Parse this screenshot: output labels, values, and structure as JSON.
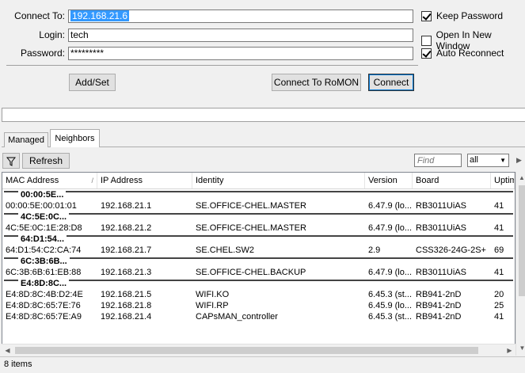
{
  "connect": {
    "connect_to_label": "Connect To:",
    "connect_to_value": "192.168.21.6",
    "login_label": "Login:",
    "login_value": "tech",
    "password_label": "Password:",
    "password_value": "*********",
    "keep_password_label": "Keep Password",
    "keep_password_checked": true,
    "open_new_window_label": "Open In New Window",
    "open_new_window_checked": false,
    "auto_reconnect_label": "Auto Reconnect",
    "auto_reconnect_checked": true,
    "add_set_label": "Add/Set",
    "connect_romon_label": "Connect To RoMON",
    "connect_label": "Connect"
  },
  "tabs": [
    {
      "label": "Managed",
      "active": false
    },
    {
      "label": "Neighbors",
      "active": true
    }
  ],
  "toolbar": {
    "filter_icon": "filter-icon",
    "refresh_label": "Refresh",
    "find_placeholder": "Find",
    "scope_value": "all"
  },
  "table": {
    "columns": [
      "MAC Address",
      "IP Address",
      "Identity",
      "Version",
      "Board",
      "Uptime"
    ],
    "groups": [
      {
        "label": "00:00:5E...",
        "rows": [
          [
            "00:00:5E:00:01:01",
            "192.168.21.1",
            "SE.OFFICE-CHEL.MASTER",
            "6.47.9 (lo...",
            "RB3011UiAS",
            "41"
          ]
        ]
      },
      {
        "label": "4C:5E:0C...",
        "rows": [
          [
            "4C:5E:0C:1E:28:D8",
            "192.168.21.2",
            "SE.OFFICE-CHEL.MASTER",
            "6.47.9 (lo...",
            "RB3011UiAS",
            "41"
          ]
        ]
      },
      {
        "label": "64:D1:54...",
        "rows": [
          [
            "64:D1:54:C2:CA:74",
            "192.168.21.7",
            "SE.CHEL.SW2",
            "2.9",
            "CSS326-24G-2S+",
            "69"
          ]
        ]
      },
      {
        "label": "6C:3B:6B...",
        "rows": [
          [
            "6C:3B:6B:61:EB:88",
            "192.168.21.3",
            "SE.OFFICE-CHEL.BACKUP",
            "6.47.9 (lo...",
            "RB3011UiAS",
            "41"
          ]
        ]
      },
      {
        "label": "E4:8D:8C...",
        "rows": [
          [
            "E4:8D:8C:4B:D2:4E",
            "192.168.21.5",
            "WIFI.KO",
            "6.45.3 (st...",
            "RB941-2nD",
            "20"
          ],
          [
            "E4:8D:8C:65:7E:76",
            "192.168.21.8",
            "WIFI.RP",
            "6.45.9 (lo...",
            "RB941-2nD",
            "25"
          ],
          [
            "E4:8D:8C:65:7E:A9",
            "192.168.21.4",
            "CAPsMAN_controller",
            "6.45.3 (st...",
            "RB941-2nD",
            "41"
          ]
        ]
      }
    ]
  },
  "status": {
    "items_count": "8 items"
  }
}
